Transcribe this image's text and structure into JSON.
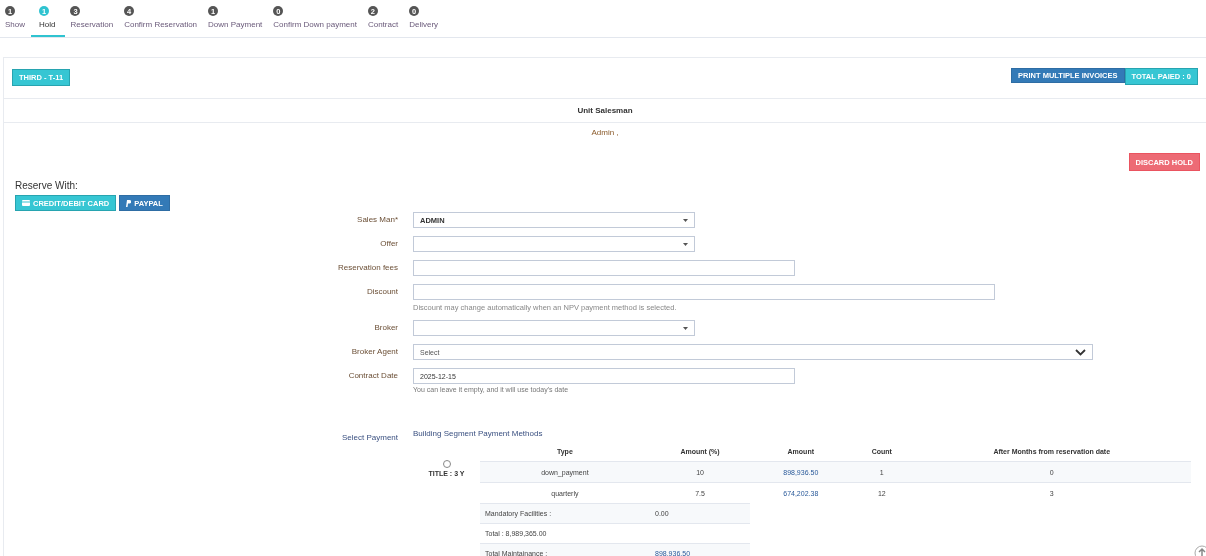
{
  "steps": [
    {
      "count": "1",
      "label": "Show",
      "selected": false
    },
    {
      "count": "1",
      "label": "Hold",
      "selected": true
    },
    {
      "count": "3",
      "label": "Reservation",
      "selected": false
    },
    {
      "count": "4",
      "label": "Confirm Reservation",
      "selected": false
    },
    {
      "count": "1",
      "label": "Down Payment",
      "selected": false
    },
    {
      "count": "0",
      "label": "Confirm Down payment",
      "selected": false
    },
    {
      "count": "2",
      "label": "Contract",
      "selected": false
    },
    {
      "count": "0",
      "label": "Delivery",
      "selected": false
    }
  ],
  "unit_button": "THIRD - T-11",
  "print_button": "PRINT MULTIPLE INVOICES",
  "total_paid": "TOTAL PAIED : 0",
  "salesman_header": "Unit Salesman",
  "salesman_value": "Admin ,",
  "discard_button": "DISCARD HOLD",
  "reserve_with": {
    "label": "Reserve With:",
    "buttons": [
      {
        "label": "CREDIT/DEBIT CARD",
        "kind": "card"
      },
      {
        "label": "PAYPAL",
        "kind": "paypal"
      }
    ]
  },
  "form": [
    {
      "label": "Sales Man*",
      "kind": "select",
      "value": "ADMIN"
    },
    {
      "label": "Offer",
      "kind": "select"
    },
    {
      "label": "Reservation fees",
      "kind": "input"
    },
    {
      "label": "Discount",
      "kind": "input",
      "hint": "Discount may change automatically when an NPV payment method is selected."
    },
    {
      "label": "Broker",
      "kind": "select"
    },
    {
      "label": "Broker Agent",
      "kind": "search-select",
      "placeholder": "Select"
    },
    {
      "label": "Contract Date",
      "kind": "input",
      "value": "2025-12-15",
      "hint": "You can leave it empty, and it will use today's date"
    }
  ],
  "payment": {
    "label": "Select Payment",
    "heading": "Building Segment Payment Methods",
    "plan": {
      "title": "TITLE : 3 Y",
      "selected": false,
      "columns": [
        "Type",
        "Amount (%)",
        "Amount",
        "Count",
        "After Months from reservation date"
      ],
      "rows": [
        [
          "down_payment",
          "10",
          "898,936.50",
          "1",
          "0"
        ],
        [
          "quarterly",
          "7.5",
          "674,202.38",
          "12",
          "3"
        ]
      ],
      "mandatory_facilities": {
        "label": "Mandatory Facilities :",
        "value": "0.00"
      },
      "total": "Total : 8,989,365.00",
      "total_maintenance": {
        "label": "Total Maintainance :",
        "value": "898,936.50"
      }
    }
  }
}
